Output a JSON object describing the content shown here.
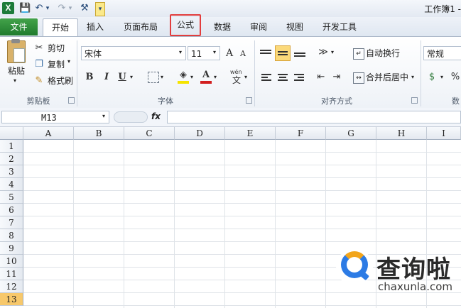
{
  "titlebar": {
    "app_icon_letter": "X",
    "title": "工作簿1 -",
    "qa_save": "💾",
    "qa_undo": "↶",
    "qa_undo_caret": "▾",
    "qa_redo": "↷",
    "qa_redo_caret": "▾",
    "qa_tools": "⚒",
    "qa_custom": "▾"
  },
  "tabs": {
    "file": "文件",
    "items": [
      "开始",
      "插入",
      "页面布局",
      "公式",
      "数据",
      "审阅",
      "视图",
      "开发工具"
    ],
    "active": "开始",
    "highlighted": "公式"
  },
  "clipboard": {
    "paste": "粘贴",
    "cut": "剪切",
    "copy": "复制",
    "format_painter": "格式刷",
    "group": "剪贴板"
  },
  "font": {
    "name": "宋体",
    "size": "11",
    "grow": "A",
    "shrink": "A",
    "bold": "B",
    "italic": "I",
    "underline": "U",
    "font_color_letter": "A",
    "phonetic": "wén",
    "group": "字体",
    "highlight_color": "#f5e400",
    "font_color": "#d21f1f"
  },
  "alignment": {
    "wrap": "自动换行",
    "merge": "合并后居中",
    "group": "对齐方式"
  },
  "number": {
    "format": "常规",
    "percent": "%",
    "group": "数"
  },
  "formula_bar": {
    "name_box": "M13",
    "fx": "fx"
  },
  "grid": {
    "columns": [
      "A",
      "B",
      "C",
      "D",
      "E",
      "F",
      "G",
      "H",
      "I"
    ],
    "rows": [
      "1",
      "2",
      "3",
      "4",
      "5",
      "6",
      "7",
      "8",
      "9",
      "10",
      "11",
      "12",
      "13"
    ],
    "selected_row": "13"
  },
  "watermark": {
    "text": "查询啦",
    "url": "chaxunla.com"
  }
}
